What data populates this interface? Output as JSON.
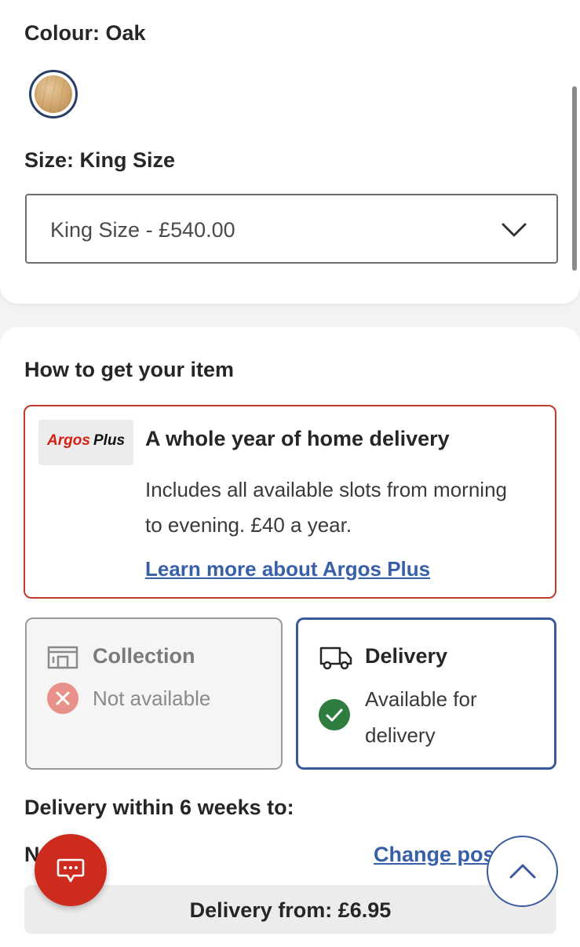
{
  "colour": {
    "label": "Colour: Oak",
    "swatch_color": "#d4ab74"
  },
  "size": {
    "label": "Size: King Size",
    "selected": "King Size - £540.00"
  },
  "fulfilment": {
    "heading": "How to get your item",
    "argos_plus": {
      "logo_argos": "Argos",
      "logo_plus": "Plus",
      "title": "A whole year of home delivery",
      "description": "Includes all available slots from morning to evening. £40 a year.",
      "link": "Learn more about Argos Plus",
      "border_color": "#c0392b"
    },
    "collection": {
      "title": "Collection",
      "status": "Not available",
      "icon": "store-icon"
    },
    "delivery": {
      "title": "Delivery",
      "status": "Available for delivery",
      "icon": "van-icon",
      "accent": "#3a5a9c"
    }
  },
  "delivery_info": {
    "heading": "Delivery within 6 weeks to:",
    "postcode": "N     B",
    "change_link": "Change pos",
    "fee": "Delivery from: £6.95"
  },
  "floating": {
    "chat_icon": "chat-icon",
    "back_to_top_icon": "chevron-up-icon",
    "chat_color": "#cc2b1d"
  }
}
